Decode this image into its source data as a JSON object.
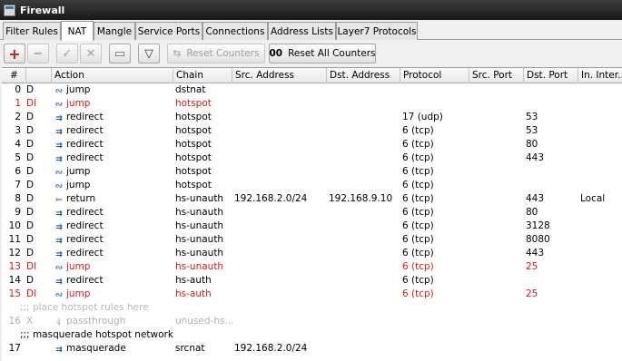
{
  "window": {
    "title": "Firewall"
  },
  "tabs": [
    {
      "label": "Filter Rules",
      "active": false
    },
    {
      "label": "NAT",
      "active": true
    },
    {
      "label": "Mangle",
      "active": false
    },
    {
      "label": "Service Ports",
      "active": false
    },
    {
      "label": "Connections",
      "active": false
    },
    {
      "label": "Address Lists",
      "active": false
    },
    {
      "label": "Layer7 Protocols",
      "active": false
    }
  ],
  "toolbar": {
    "add_glyph": "+",
    "remove_glyph": "−",
    "enable_glyph": "✓",
    "disable_glyph": "✕",
    "comment_glyph": "▭",
    "filter_glyph": "▽",
    "reset_counters_label": "Reset Counters",
    "reset_counters_glyph": "⇆",
    "reset_all_label": "Reset All Counters",
    "reset_all_glyph": "00"
  },
  "columns": [
    "#",
    "",
    "Action",
    "Chain",
    "Src. Address",
    "Dst. Address",
    "Protocol",
    "Src. Port",
    "Dst. Port",
    "In. Inter..."
  ],
  "rows": [
    {
      "type": "rule",
      "num": "0",
      "flag": "D",
      "action": "jump",
      "icon": "jump",
      "chain": "dstnat",
      "src": "",
      "dst": "",
      "proto": "",
      "sport": "",
      "dport": "",
      "iif": "",
      "state": "normal"
    },
    {
      "type": "rule",
      "num": "1",
      "flag": "DI",
      "action": "jump",
      "icon": "jump",
      "chain": "hotspot",
      "src": "",
      "dst": "",
      "proto": "",
      "sport": "",
      "dport": "",
      "iif": "",
      "state": "disabled"
    },
    {
      "type": "rule",
      "num": "2",
      "flag": "D",
      "action": "redirect",
      "icon": "redirect",
      "chain": "hotspot",
      "src": "",
      "dst": "",
      "proto": "17 (udp)",
      "sport": "",
      "dport": "53",
      "iif": "",
      "state": "normal"
    },
    {
      "type": "rule",
      "num": "3",
      "flag": "D",
      "action": "redirect",
      "icon": "redirect",
      "chain": "hotspot",
      "src": "",
      "dst": "",
      "proto": "6 (tcp)",
      "sport": "",
      "dport": "53",
      "iif": "",
      "state": "normal"
    },
    {
      "type": "rule",
      "num": "4",
      "flag": "D",
      "action": "redirect",
      "icon": "redirect",
      "chain": "hotspot",
      "src": "",
      "dst": "",
      "proto": "6 (tcp)",
      "sport": "",
      "dport": "80",
      "iif": "",
      "state": "normal"
    },
    {
      "type": "rule",
      "num": "5",
      "flag": "D",
      "action": "redirect",
      "icon": "redirect",
      "chain": "hotspot",
      "src": "",
      "dst": "",
      "proto": "6 (tcp)",
      "sport": "",
      "dport": "443",
      "iif": "",
      "state": "normal"
    },
    {
      "type": "rule",
      "num": "6",
      "flag": "D",
      "action": "jump",
      "icon": "jump",
      "chain": "hotspot",
      "src": "",
      "dst": "",
      "proto": "6 (tcp)",
      "sport": "",
      "dport": "",
      "iif": "",
      "state": "normal"
    },
    {
      "type": "rule",
      "num": "7",
      "flag": "D",
      "action": "jump",
      "icon": "jump",
      "chain": "hotspot",
      "src": "",
      "dst": "",
      "proto": "6 (tcp)",
      "sport": "",
      "dport": "",
      "iif": "",
      "state": "normal"
    },
    {
      "type": "rule",
      "num": "8",
      "flag": "D",
      "action": "return",
      "icon": "return",
      "chain": "hs-unauth",
      "src": "192.168.2.0/24",
      "dst": "192.168.9.10",
      "proto": "6 (tcp)",
      "sport": "",
      "dport": "443",
      "iif": "Local",
      "state": "normal"
    },
    {
      "type": "rule",
      "num": "9",
      "flag": "D",
      "action": "redirect",
      "icon": "redirect",
      "chain": "hs-unauth",
      "src": "",
      "dst": "",
      "proto": "6 (tcp)",
      "sport": "",
      "dport": "80",
      "iif": "",
      "state": "normal"
    },
    {
      "type": "rule",
      "num": "10",
      "flag": "D",
      "action": "redirect",
      "icon": "redirect",
      "chain": "hs-unauth",
      "src": "",
      "dst": "",
      "proto": "6 (tcp)",
      "sport": "",
      "dport": "3128",
      "iif": "",
      "state": "normal"
    },
    {
      "type": "rule",
      "num": "11",
      "flag": "D",
      "action": "redirect",
      "icon": "redirect",
      "chain": "hs-unauth",
      "src": "",
      "dst": "",
      "proto": "6 (tcp)",
      "sport": "",
      "dport": "8080",
      "iif": "",
      "state": "normal"
    },
    {
      "type": "rule",
      "num": "12",
      "flag": "D",
      "action": "redirect",
      "icon": "redirect",
      "chain": "hs-unauth",
      "src": "",
      "dst": "",
      "proto": "6 (tcp)",
      "sport": "",
      "dport": "443",
      "iif": "",
      "state": "normal"
    },
    {
      "type": "rule",
      "num": "13",
      "flag": "DI",
      "action": "jump",
      "icon": "jump",
      "chain": "hs-unauth",
      "src": "",
      "dst": "",
      "proto": "6 (tcp)",
      "sport": "",
      "dport": "25",
      "iif": "",
      "state": "disabled"
    },
    {
      "type": "rule",
      "num": "14",
      "flag": "D",
      "action": "redirect",
      "icon": "redirect",
      "chain": "hs-auth",
      "src": "",
      "dst": "",
      "proto": "6 (tcp)",
      "sport": "",
      "dport": "",
      "iif": "",
      "state": "normal"
    },
    {
      "type": "rule",
      "num": "15",
      "flag": "DI",
      "action": "jump",
      "icon": "jump",
      "chain": "hs-auth",
      "src": "",
      "dst": "",
      "proto": "6 (tcp)",
      "sport": "",
      "dport": "25",
      "iif": "",
      "state": "disabled"
    },
    {
      "type": "comment",
      "text": ";;; place hotspot rules here",
      "state": "ghost"
    },
    {
      "type": "rule",
      "num": "16",
      "flag": "X",
      "action": "passthrough",
      "icon": "pass",
      "chain": "unused-hs...",
      "src": "",
      "dst": "",
      "proto": "",
      "sport": "",
      "dport": "",
      "iif": "",
      "state": "ghost"
    },
    {
      "type": "comment",
      "text": ";;; masquerade hotspot network",
      "state": "normal"
    },
    {
      "type": "rule",
      "num": "17",
      "flag": "",
      "action": "masquerade",
      "icon": "masq",
      "chain": "srcnat",
      "src": "192.168.2.0/24",
      "dst": "",
      "proto": "",
      "sport": "",
      "dport": "",
      "iif": "",
      "state": "normal"
    }
  ],
  "icons": {
    "jump": "∾",
    "redirect": "⇉",
    "return": "⇐",
    "pass": "⇓",
    "masq": "⇉"
  },
  "colors": {
    "disabled": "#d81818",
    "ghost": "#b0b0b0",
    "jump_icon": "#3a6fc8"
  }
}
